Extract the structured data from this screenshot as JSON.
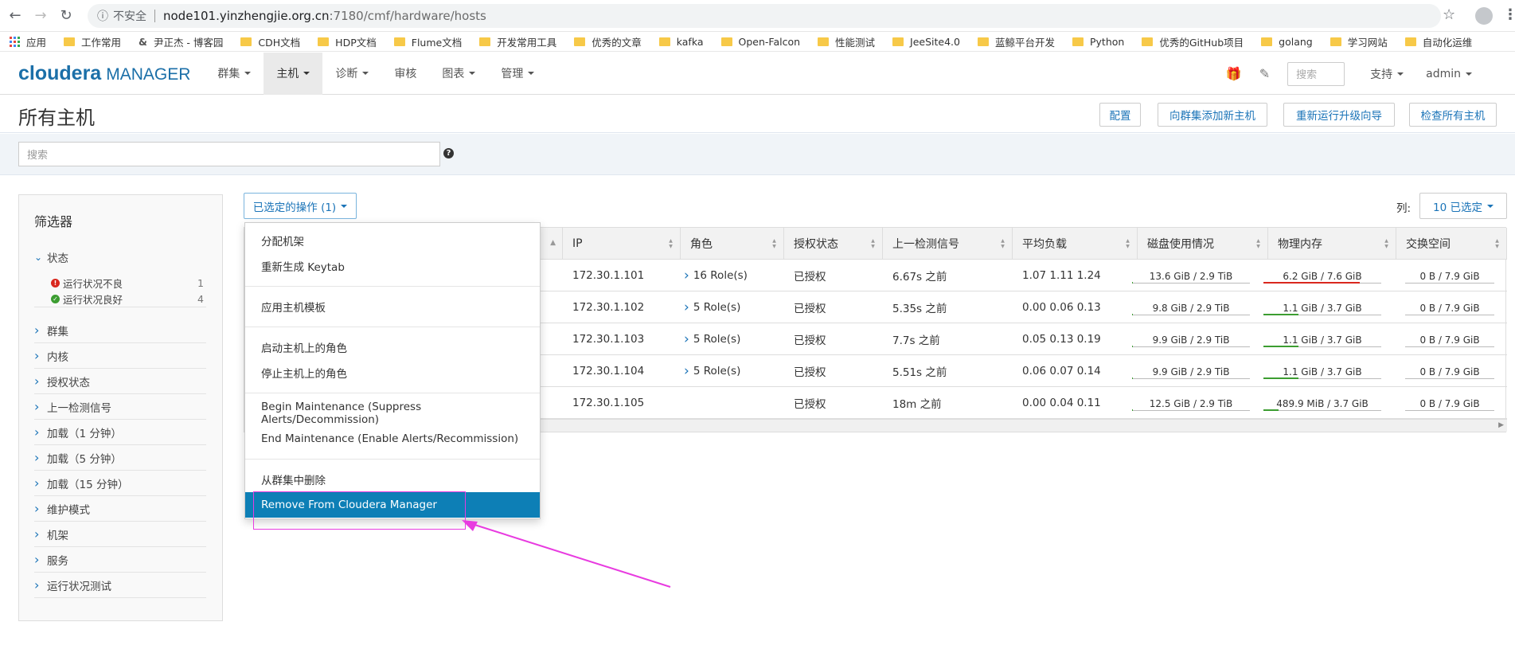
{
  "browser": {
    "security_label": "不安全",
    "url_host": "node101.yinzhengjie.org.cn",
    "url_path": ":7180/cmf/hardware/hosts"
  },
  "bookmarks": [
    "应用",
    "工作常用",
    "尹正杰 - 博客园",
    "CDH文档",
    "HDP文档",
    "Flume文档",
    "开发常用工具",
    "优秀的文章",
    "kafka",
    "Open-Falcon",
    "性能测试",
    "JeeSite4.0",
    "蓝鲸平台开发",
    "Python",
    "优秀的GitHub项目",
    "golang",
    "学习网站",
    "自动化运维"
  ],
  "brand": {
    "name": "cloudera",
    "product": "MANAGER",
    "color": "#1b6fa8"
  },
  "nav": {
    "items": [
      {
        "label": "群集",
        "dropdown": true
      },
      {
        "label": "主机",
        "dropdown": true,
        "active": true
      },
      {
        "label": "诊断",
        "dropdown": true
      },
      {
        "label": "审核",
        "dropdown": false
      },
      {
        "label": "图表",
        "dropdown": true
      },
      {
        "label": "管理",
        "dropdown": true
      }
    ],
    "search_placeholder": "搜索",
    "support": "支持",
    "user": "admin",
    "icons": [
      "gift-icon",
      "pen-icon"
    ]
  },
  "page": {
    "title": "所有主机",
    "buttons": [
      "配置",
      "向群集添加新主机",
      "重新运行升级向导",
      "检查所有主机"
    ],
    "search_placeholder": "搜索"
  },
  "filters": {
    "title": "筛选器",
    "status_label": "状态",
    "status_rows": [
      {
        "label": "运行状况不良",
        "count": "1",
        "color": "#d9281e"
      },
      {
        "label": "运行状况良好",
        "count": "4",
        "color": "#3c9d31"
      }
    ],
    "sections": [
      "群集",
      "内核",
      "授权状态",
      "上一检测信号",
      "加载（1 分钟）",
      "加载（5 分钟）",
      "加载（15 分钟）",
      "维护模式",
      "机架",
      "服务",
      "运行状况测试"
    ]
  },
  "actions": {
    "button_label": "已选定的操作 (1)",
    "columns_label": "列:",
    "columns_value": "10 已选定",
    "menu": [
      [
        "分配机架",
        "重新生成 Keytab"
      ],
      [
        "应用主机模板"
      ],
      [
        "启动主机上的角色",
        "停止主机上的角色"
      ],
      [
        "Begin Maintenance (Suppress Alerts/Decommission)",
        "End Maintenance (Enable Alerts/Recommission)"
      ],
      [
        "从群集中删除",
        "Remove From Cloudera Manager"
      ]
    ],
    "highlighted": "Remove From Cloudera Manager",
    "highlight_color": "#0d7fb6"
  },
  "table": {
    "headers": [
      "IP",
      "角色",
      "授权状态",
      "上一检测信号",
      "平均负载",
      "磁盘使用情况",
      "物理内存",
      "交换空间"
    ],
    "rows": [
      {
        "ip": "172.30.1.101",
        "roles": "16 Role(s)",
        "auth": "已授权",
        "heartbeat": "6.67s 之前",
        "load": "1.07  1.11  1.24",
        "disk": "13.6 GiB / 2.9 TiB",
        "disk_pct": 0.005,
        "mem": "6.2 GiB / 7.6 GiB",
        "mem_pct": 0.82,
        "mem_color": "#d9281e",
        "swap": "0 B / 7.9 GiB"
      },
      {
        "ip": "172.30.1.102",
        "roles": "5 Role(s)",
        "auth": "已授权",
        "heartbeat": "5.35s 之前",
        "load": "0.00  0.06  0.13",
        "disk": "9.8 GiB / 2.9 TiB",
        "disk_pct": 0.003,
        "mem": "1.1 GiB / 3.7 GiB",
        "mem_pct": 0.3,
        "mem_color": "#3c9d31",
        "swap": "0 B / 7.9 GiB"
      },
      {
        "ip": "172.30.1.103",
        "roles": "5 Role(s)",
        "auth": "已授权",
        "heartbeat": "7.7s 之前",
        "load": "0.05  0.13  0.19",
        "disk": "9.9 GiB / 2.9 TiB",
        "disk_pct": 0.003,
        "mem": "1.1 GiB / 3.7 GiB",
        "mem_pct": 0.3,
        "mem_color": "#3c9d31",
        "swap": "0 B / 7.9 GiB"
      },
      {
        "ip": "172.30.1.104",
        "roles": "5 Role(s)",
        "auth": "已授权",
        "heartbeat": "5.51s 之前",
        "load": "0.06  0.07  0.14",
        "disk": "9.9 GiB / 2.9 TiB",
        "disk_pct": 0.003,
        "mem": "1.1 GiB / 3.7 GiB",
        "mem_pct": 0.3,
        "mem_color": "#3c9d31",
        "swap": "0 B / 7.9 GiB"
      },
      {
        "ip": "172.30.1.105",
        "roles": "",
        "auth": "已授权",
        "heartbeat": "18m 之前",
        "load": "0.00  0.04  0.11",
        "disk": "12.5 GiB / 2.9 TiB",
        "disk_pct": 0.004,
        "mem": "489.9 MiB / 3.7 GiB",
        "mem_pct": 0.13,
        "mem_color": "#3c9d31",
        "swap": "0 B / 7.9 GiB"
      }
    ]
  },
  "annotation_color": "#e83be0"
}
